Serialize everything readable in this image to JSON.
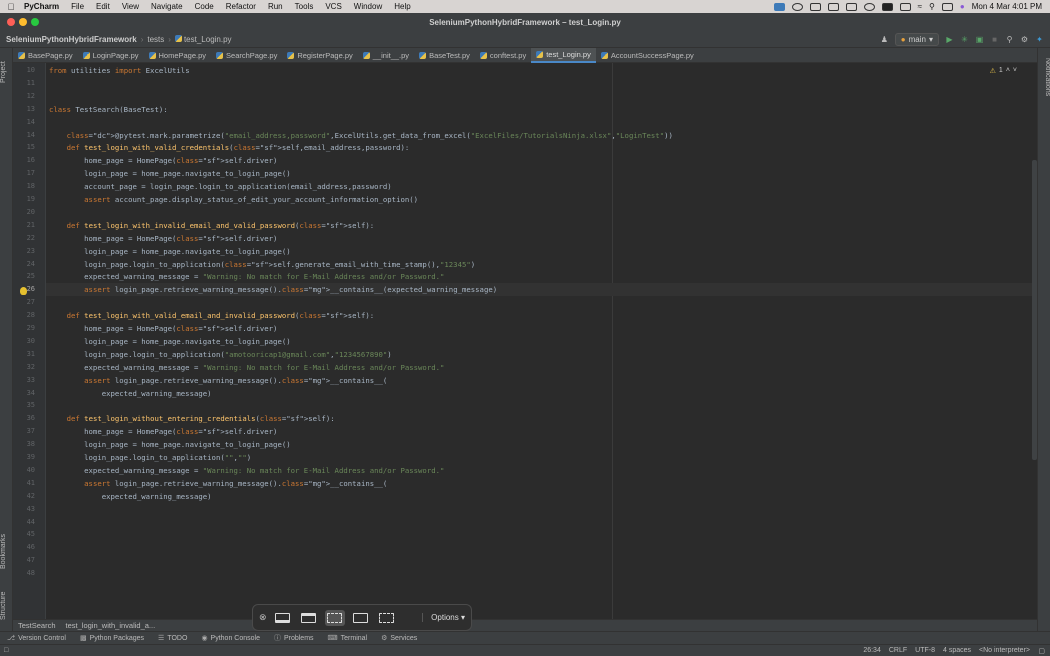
{
  "menubar": {
    "app_name": "PyCharm",
    "items": [
      "File",
      "Edit",
      "View",
      "Navigate",
      "Code",
      "Refactor",
      "Run",
      "Tools",
      "VCS",
      "Window",
      "Help"
    ],
    "clock": "Mon 4 Mar  4:01 PM"
  },
  "window": {
    "title": "SeleniumPythonHybridFramework – test_Login.py"
  },
  "navbar": {
    "project": "SeleniumPythonHybridFramework",
    "folder": "tests",
    "file": "test_Login.py",
    "branch": "main"
  },
  "tabs": [
    {
      "label": "BasePage.py"
    },
    {
      "label": "LoginPage.py"
    },
    {
      "label": "HomePage.py"
    },
    {
      "label": "SearchPage.py"
    },
    {
      "label": "RegisterPage.py"
    },
    {
      "label": "__init__.py"
    },
    {
      "label": "BaseTest.py"
    },
    {
      "label": "conftest.py"
    },
    {
      "label": "test_Login.py"
    },
    {
      "label": "AccountSuccessPage.py"
    }
  ],
  "sidebars": {
    "project": "Project",
    "bookmarks": "Bookmarks",
    "structure": "Structure",
    "notifications": "Notifications"
  },
  "editor": {
    "warnings": "1",
    "lines": [
      {
        "n": "10",
        "code": "from utilities import ExcelUtils"
      },
      {
        "n": "11",
        "code": ""
      },
      {
        "n": "12",
        "code": ""
      },
      {
        "n": "13",
        "code": "class TestSearch(BaseTest):"
      },
      {
        "n": "14",
        "code": ""
      },
      {
        "n": "14",
        "code": "    @pytest.mark.parametrize(\"email_address,password\",ExcelUtils.get_data_from_excel(\"ExcelFiles/TutorialsNinja.xlsx\",\"LoginTest\"))"
      },
      {
        "n": "15",
        "code": "    def test_login_with_valid_credentials(self,email_address,password):"
      },
      {
        "n": "16",
        "code": "        home_page = HomePage(self.driver)"
      },
      {
        "n": "17",
        "code": "        login_page = home_page.navigate_to_login_page()"
      },
      {
        "n": "18",
        "code": "        account_page = login_page.login_to_application(email_address,password)"
      },
      {
        "n": "19",
        "code": "        assert account_page.display_status_of_edit_your_account_information_option()"
      },
      {
        "n": "20",
        "code": ""
      },
      {
        "n": "21",
        "code": "    def test_login_with_invalid_email_and_valid_password(self):"
      },
      {
        "n": "22",
        "code": "        home_page = HomePage(self.driver)"
      },
      {
        "n": "23",
        "code": "        login_page = home_page.navigate_to_login_page()"
      },
      {
        "n": "24",
        "code": "        login_page.login_to_application(self.generate_email_with_time_stamp(),\"12345\")"
      },
      {
        "n": "25",
        "code": "        expected_warning_message = \"Warning: No match for E-Mail Address and/or Password.\""
      },
      {
        "n": "26",
        "code": "        assert login_page.retrieve_warning_message().__contains__(expected_warning_message)"
      },
      {
        "n": "27",
        "code": ""
      },
      {
        "n": "28",
        "code": "    def test_login_with_valid_email_and_invalid_password(self):"
      },
      {
        "n": "29",
        "code": "        home_page = HomePage(self.driver)"
      },
      {
        "n": "30",
        "code": "        login_page = home_page.navigate_to_login_page()"
      },
      {
        "n": "31",
        "code": "        login_page.login_to_application(\"amotooricap1@gmail.com\",\"1234567890\")"
      },
      {
        "n": "32",
        "code": "        expected_warning_message = \"Warning: No match for E-Mail Address and/or Password.\""
      },
      {
        "n": "33",
        "code": "        assert login_page.retrieve_warning_message().__contains__("
      },
      {
        "n": "34",
        "code": "            expected_warning_message)"
      },
      {
        "n": "35",
        "code": ""
      },
      {
        "n": "36",
        "code": "    def test_login_without_entering_credentials(self):"
      },
      {
        "n": "37",
        "code": "        home_page = HomePage(self.driver)"
      },
      {
        "n": "38",
        "code": "        login_page = home_page.navigate_to_login_page()"
      },
      {
        "n": "39",
        "code": "        login_page.login_to_application(\"\",\"\")"
      },
      {
        "n": "40",
        "code": "        expected_warning_message = \"Warning: No match for E-Mail Address and/or Password.\""
      },
      {
        "n": "41",
        "code": "        assert login_page.retrieve_warning_message().__contains__("
      },
      {
        "n": "42",
        "code": "            expected_warning_message)"
      },
      {
        "n": "43",
        "code": ""
      },
      {
        "n": "44",
        "code": ""
      },
      {
        "n": "45",
        "code": ""
      },
      {
        "n": "46",
        "code": ""
      },
      {
        "n": "47",
        "code": ""
      },
      {
        "n": "48",
        "code": ""
      }
    ]
  },
  "breadcrumbs": [
    "TestSearch",
    "test_login_with_invalid_a..."
  ],
  "capture_toolbar": {
    "options_label": "Options"
  },
  "tool_windows": [
    {
      "label": "Version Control",
      "icon": "branch-icon"
    },
    {
      "label": "Python Packages",
      "icon": "package-icon"
    },
    {
      "label": "TODO",
      "icon": "list-icon"
    },
    {
      "label": "Python Console",
      "icon": "python-icon"
    },
    {
      "label": "Problems",
      "icon": "info-icon"
    },
    {
      "label": "Terminal",
      "icon": "terminal-icon"
    },
    {
      "label": "Services",
      "icon": "gear-icon"
    }
  ],
  "statusbar": {
    "position": "26:34",
    "line_sep": "CRLF",
    "encoding": "UTF-8",
    "indent": "4 spaces",
    "interpreter": "<No interpreter>"
  }
}
